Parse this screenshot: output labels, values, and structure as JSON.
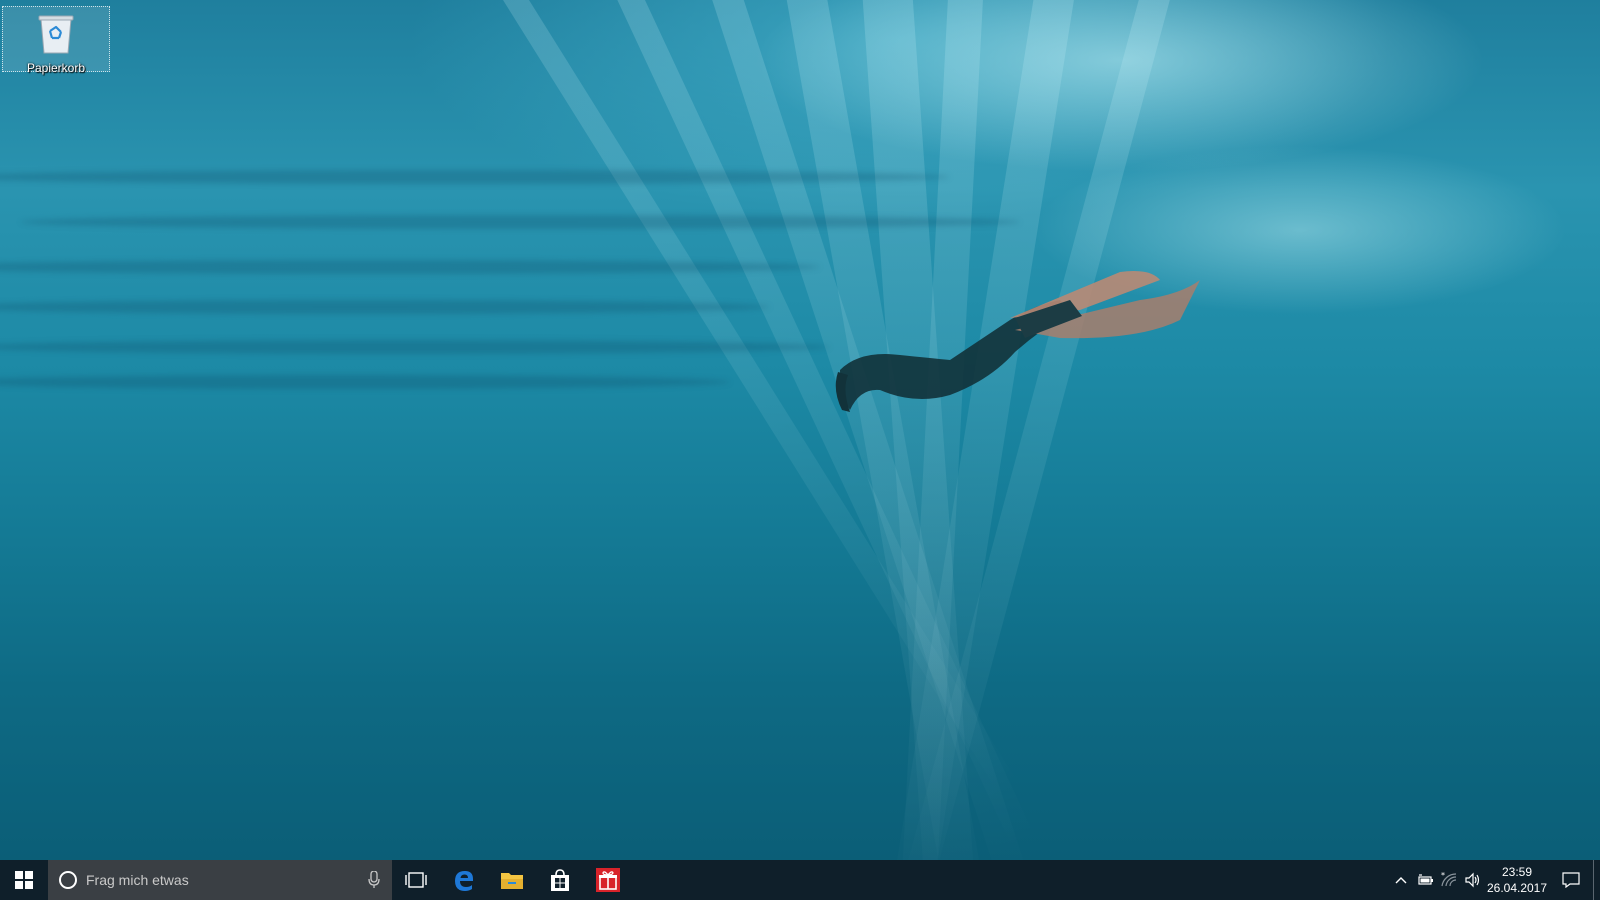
{
  "desktop": {
    "icons": [
      {
        "label": "Papierkorb",
        "icon": "recycle-bin-icon"
      }
    ]
  },
  "taskbar": {
    "start_icon": "windows-logo-icon",
    "search": {
      "placeholder": "Frag mich etwas",
      "cortana_icon": "cortana-circle-icon",
      "mic_icon": "microphone-icon"
    },
    "task_view_icon": "task-view-icon",
    "apps": [
      {
        "name": "Microsoft Edge",
        "icon": "edge-icon"
      },
      {
        "name": "Datei-Explorer",
        "icon": "folder-icon"
      },
      {
        "name": "Store",
        "icon": "store-icon"
      },
      {
        "name": "Geschenk-App",
        "icon": "gift-icon"
      }
    ],
    "tray": {
      "icons": [
        "chevron-up-icon",
        "battery-plug-icon",
        "wifi-icon",
        "speaker-icon"
      ],
      "time": "23:59",
      "date": "26.04.2017",
      "action_center_icon": "notification-icon"
    },
    "colors": {
      "taskbar_bg": "#0f1f2a",
      "search_bg": "#3a3f44",
      "edge_blue": "#1e78d7",
      "folder_yellow": "#f4c542",
      "gift_red": "#d8232a"
    }
  }
}
